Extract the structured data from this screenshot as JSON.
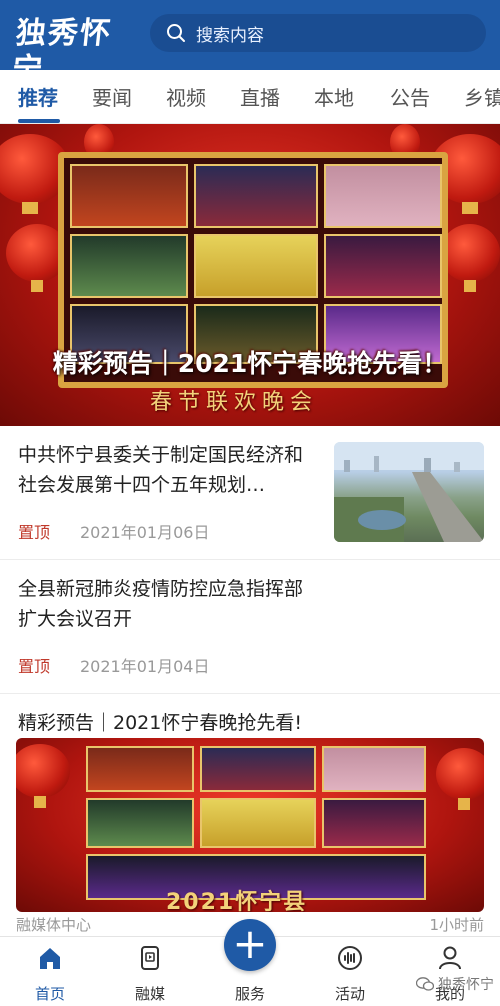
{
  "header": {
    "logo_text": "独秀怀宁",
    "search_placeholder": "搜索内容",
    "icon": "search-icon"
  },
  "tabs": [
    {
      "label": "推荐",
      "active": true
    },
    {
      "label": "要闻",
      "active": false
    },
    {
      "label": "视频",
      "active": false
    },
    {
      "label": "直播",
      "active": false
    },
    {
      "label": "本地",
      "active": false
    },
    {
      "label": "公告",
      "active": false
    },
    {
      "label": "乡镇",
      "active": false
    }
  ],
  "banner": {
    "caption": "精彩预告｜2021怀宁春晚抢先看！",
    "subtitle": "春节联欢晚会"
  },
  "articles": [
    {
      "title": "中共怀宁县委关于制定国民经济和社会发展第十四个五年规划…",
      "pin": "置顶",
      "date": "2021年01月06日"
    },
    {
      "title": "全县新冠肺炎疫情防控应急指挥部扩大会议召开",
      "pin": "置顶",
      "date": "2021年01月04日"
    },
    {
      "title": "精彩预告｜2021怀宁春晚抢先看!",
      "source": "融媒体中心",
      "time_ago": "1小时前",
      "thumb_text": "2021怀宁县"
    }
  ],
  "bottom_nav": [
    {
      "label": "首页",
      "icon": "home-icon",
      "active": true
    },
    {
      "label": "融媒",
      "icon": "media-icon",
      "active": false
    },
    {
      "label": "服务",
      "icon": "plus-icon",
      "active": false
    },
    {
      "label": "活动",
      "icon": "audio-wave-icon",
      "active": false
    },
    {
      "label": "我的",
      "icon": "user-icon",
      "active": false
    }
  ],
  "watermark": "独秀怀宁",
  "colors": {
    "brand": "#1f5aa6",
    "pin": "#c0392b",
    "festive_red": "#b0150f",
    "gold": "#d9a441"
  }
}
